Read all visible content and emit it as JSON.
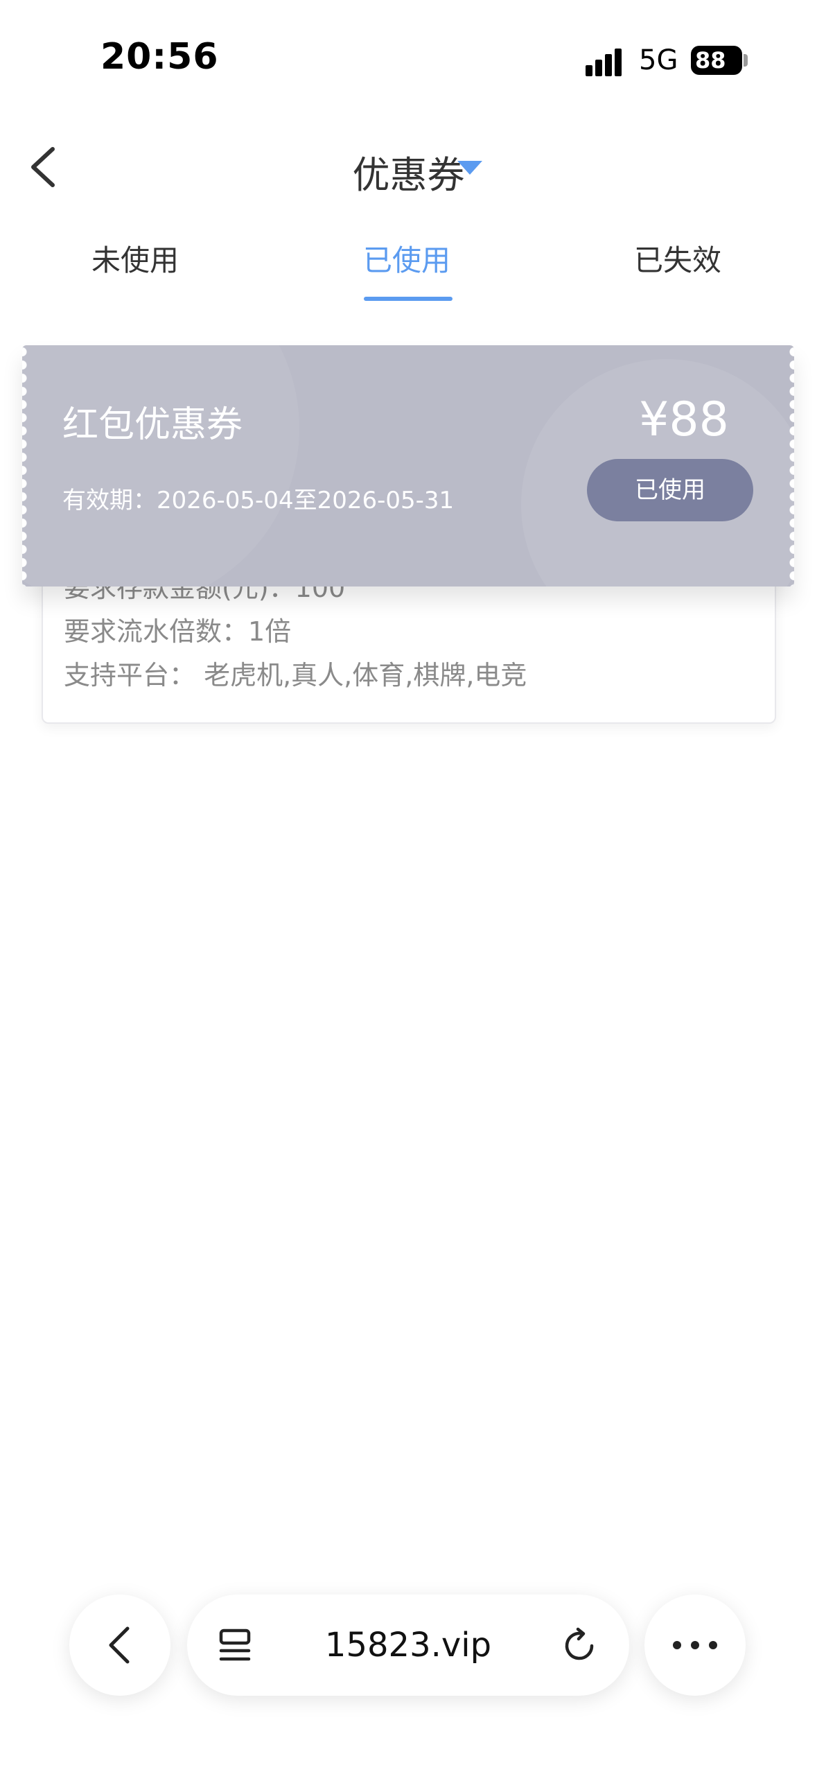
{
  "status_bar": {
    "time": "20:56",
    "network": "5G",
    "battery": "88"
  },
  "header": {
    "title": "优惠券"
  },
  "tabs": [
    {
      "label": "未使用"
    },
    {
      "label": "已使用"
    },
    {
      "label": "已失效"
    }
  ],
  "active_tab": "已使用",
  "coupon": {
    "name": "红包优惠券",
    "validity": "有效期：2026-05-04至2026-05-31",
    "amount": "¥88",
    "status_button": "已使用",
    "deposit_requirement": "要求存款金额(元)：100",
    "turnover_requirement": "要求流水倍数：1倍",
    "platforms": "支持平台：  老虎机,真人,体育,棋牌,电竞"
  },
  "browser_bar": {
    "url": "15823.vip"
  },
  "colors": {
    "accent": "#5b9bf0",
    "coupon_bg": "#babbc8",
    "used_button": "#7b809f"
  },
  "icons": {
    "back": "chevron-left-icon",
    "title_dropdown": "caret-down-icon",
    "tabs": "list-icon",
    "reload": "reload-icon",
    "more": "more-icon"
  }
}
